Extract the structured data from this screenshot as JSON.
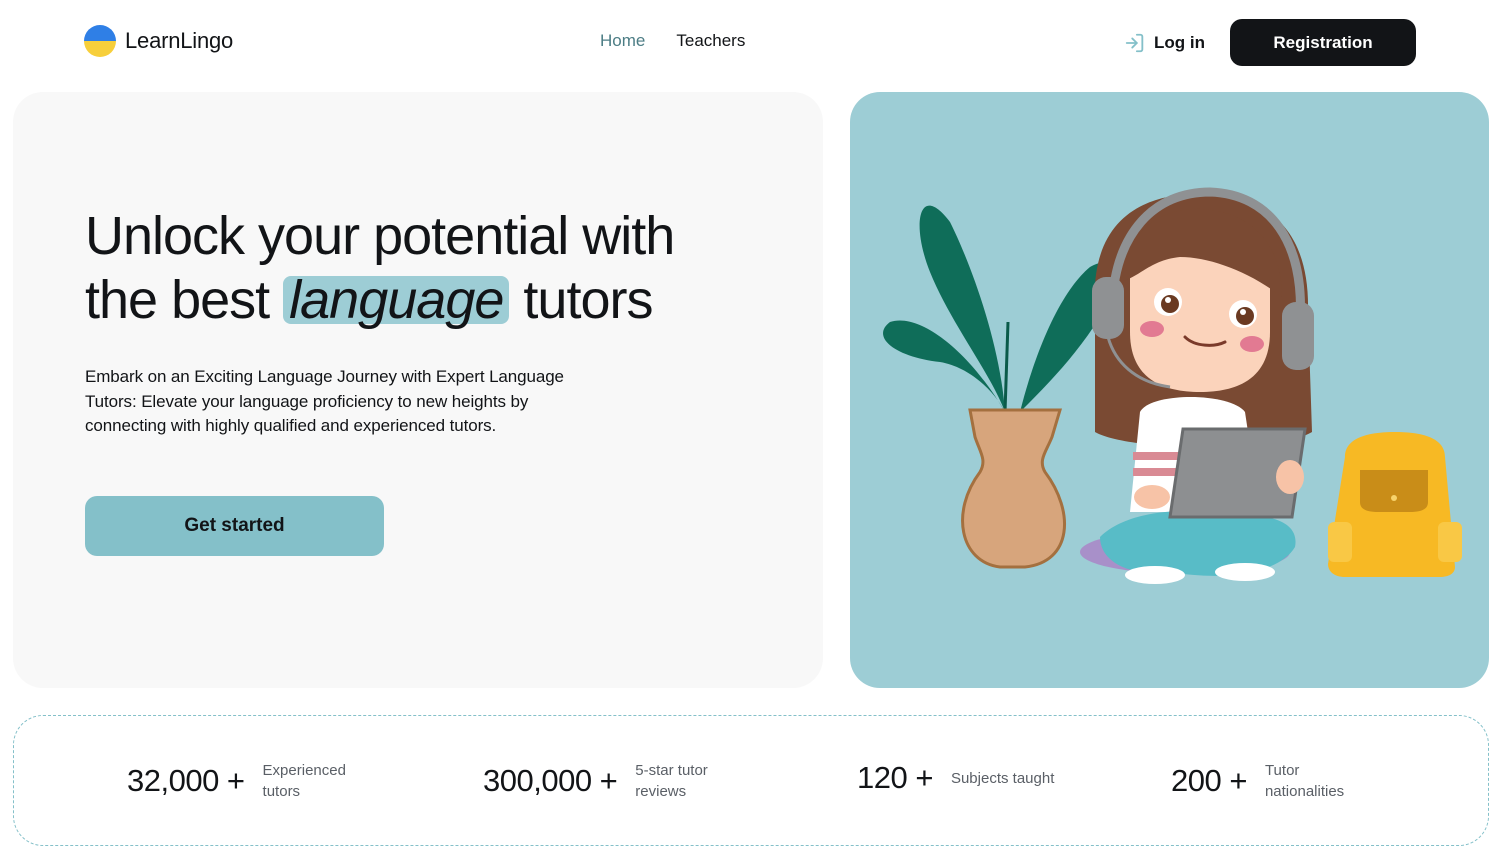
{
  "brand": {
    "name": "LearnLingo",
    "logo_colors": [
      "#2f7fe6",
      "#f7cf3b"
    ]
  },
  "nav": {
    "items": [
      {
        "label": "Home",
        "active": true
      },
      {
        "label": "Teachers",
        "active": false
      }
    ]
  },
  "auth": {
    "login_label": "Log in",
    "login_icon": "login-arrow-icon",
    "register_label": "Registration"
  },
  "hero": {
    "title_part1": "Unlock your potential with the best",
    "title_highlight": "language",
    "title_part2": "tutors",
    "description": "Embark on an Exciting Language Journey with Expert Language Tutors: Elevate your language proficiency to new heights by connecting with highly qualified and experienced tutors.",
    "cta_label": "Get started",
    "illustration": "girl-with-headphones-and-tablet-illustration"
  },
  "stats": [
    {
      "value": "32,000 +",
      "label": "Experienced tutors"
    },
    {
      "value": "300,000 +",
      "label": "5-star tutor reviews"
    },
    {
      "value": "120 +",
      "label": "Subjects taught"
    },
    {
      "value": "200 +",
      "label": "Tutor nationalities"
    }
  ],
  "colors": {
    "accent": "#9dcdd5",
    "button": "#84c0c9",
    "dark": "#121417",
    "nav_active": "#4c7d85",
    "panel": "#f8f8f8"
  }
}
